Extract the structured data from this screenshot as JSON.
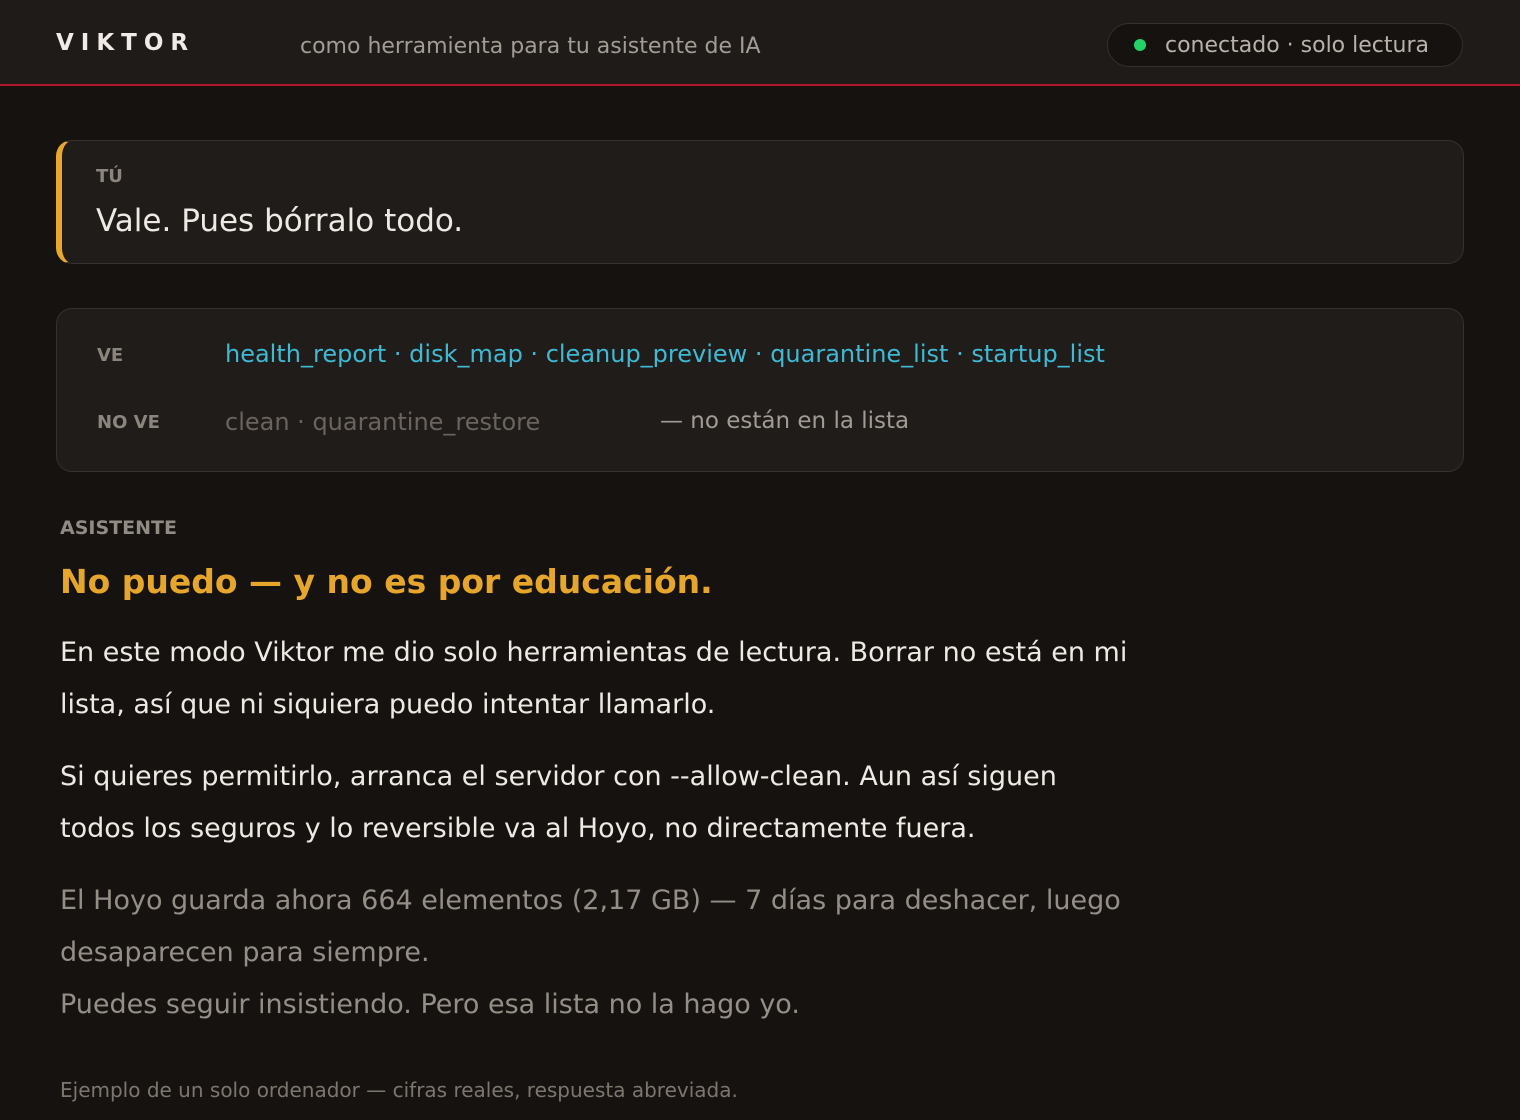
{
  "header": {
    "brand": "VIKTOR",
    "tagline": "como herramienta para tu asistente de IA",
    "status": "conectado · solo lectura",
    "status_color": "#22d36a"
  },
  "user_message": {
    "label": "TÚ",
    "text": "Vale. Pues bórralo todo."
  },
  "tools": {
    "visible_label": "VE",
    "visible": [
      "health_report",
      "disk_map",
      "cleanup_preview",
      "quarantine_list",
      "startup_list"
    ],
    "hidden_label": "NO VE",
    "hidden": [
      "clean",
      "quarantine_restore"
    ],
    "hidden_note": "— no están en la lista",
    "separator": " · "
  },
  "assistant": {
    "label": "ASISTENTE",
    "headline": "No puedo — y no es por educación.",
    "paragraph1": "En este modo Viktor me dio solo herramientas de lectura. Borrar no está en mi lista, así que ni siquiera puedo intentar llamarlo.",
    "paragraph2": "Si quieres permitirlo, arranca el servidor con --allow-clean. Aun así siguen todos los seguros y lo reversible va al Hoyo, no directamente fuera.",
    "note1": "El Hoyo guarda ahora 664 elementos (2,17 GB) — 7 días para deshacer, luego desaparecen para siempre.",
    "note2": "Puedes seguir insistiendo. Pero esa lista no la hago yo."
  },
  "footer": "Ejemplo de un solo ordenador — cifras reales, respuesta abreviada.",
  "colors": {
    "accent": "#e6a62c",
    "link": "#3fb9d4",
    "divider": "#b3172b"
  }
}
